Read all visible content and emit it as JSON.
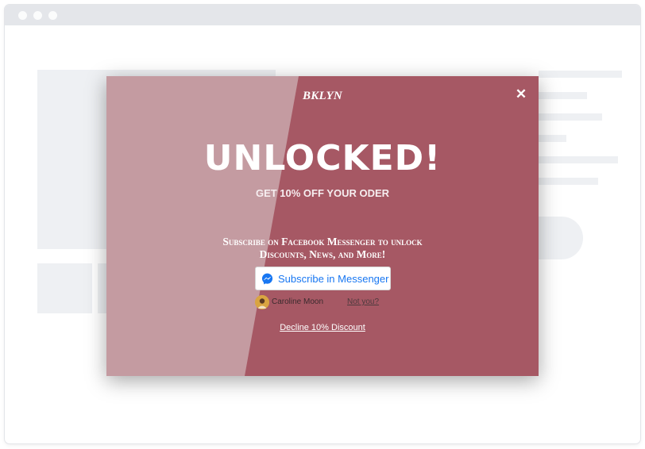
{
  "window": {
    "controls": [
      "close-dot",
      "minimize-dot",
      "maximize-dot"
    ]
  },
  "popup": {
    "brand": "BKLYN",
    "close_glyph": "✕",
    "headline": "UNLOCKED!",
    "subheadline": "GET 10% OFF YOUR ODER",
    "subscribe_line1": "Subscribe on Facebook Messenger to unlock",
    "subscribe_line2": "Discounts, News, and More!",
    "messenger_button_label": "Subscribe in Messenger",
    "user_name": "Caroline Moon",
    "not_you_label": "Not you?",
    "decline_label": "Decline 10% Discount",
    "colors": {
      "left_panel": "#c49ba1",
      "right_panel": "#a65864",
      "messenger_blue": "#1877f2"
    }
  }
}
